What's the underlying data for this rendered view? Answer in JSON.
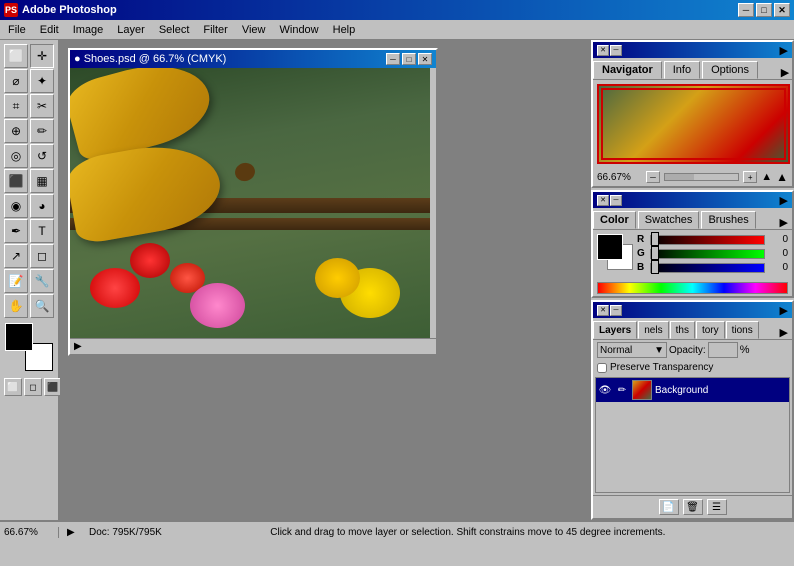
{
  "app": {
    "title": "Adobe Photoshop",
    "icon": "PS"
  },
  "titlebar": {
    "minimize": "─",
    "maximize": "□",
    "close": "✕"
  },
  "menubar": {
    "items": [
      "File",
      "Edit",
      "Image",
      "Layer",
      "Select",
      "Filter",
      "View",
      "Window",
      "Help"
    ]
  },
  "imagewindow": {
    "title": "● Shoes.psd @ 66.7% (CMYK)",
    "minimize": "─",
    "maximize": "□",
    "close": "✕"
  },
  "navigator": {
    "title": "",
    "tabs": [
      "Navigator",
      "Info",
      "Options"
    ],
    "active_tab": "Navigator",
    "zoom": "66.67%",
    "arrow_expand": "▶"
  },
  "colorpanel": {
    "title": "",
    "tabs": [
      "Color",
      "Swatches",
      "Brushes"
    ],
    "active_tab": "Color",
    "r_label": "R",
    "g_label": "G",
    "b_label": "B",
    "r_value": "0",
    "g_value": "0",
    "b_value": "0",
    "arrow_expand": "▶"
  },
  "layerspanel": {
    "title": "",
    "tabs": [
      "Layers",
      "Channels",
      "Paths",
      "History",
      "Actions"
    ],
    "tabs_short": [
      "Layers",
      "nels",
      "ths",
      "tory",
      "tions"
    ],
    "active_tab": "Layers",
    "blend_mode": "Normal",
    "opacity_label": "Opacity:",
    "opacity_value": "",
    "preserve_label": "Preserve Transparency",
    "layer_name": "Background",
    "arrow_expand": "▶",
    "footer_btns": [
      "📄",
      "🗑",
      "📁"
    ]
  },
  "statusbar": {
    "zoom": "66.67%",
    "doc_info": "Doc: 795K/795K",
    "hint": "Click and drag to move layer or selection. Shift constrains move to 45 degree increments.",
    "arrow": "▶"
  },
  "tools": {
    "items": [
      {
        "name": "marquee",
        "icon": "⬜"
      },
      {
        "name": "move",
        "icon": "✛"
      },
      {
        "name": "lasso",
        "icon": "⌀"
      },
      {
        "name": "magic-wand",
        "icon": "✦"
      },
      {
        "name": "crop",
        "icon": "⌗"
      },
      {
        "name": "slice",
        "icon": "⚡"
      },
      {
        "name": "healing",
        "icon": "⊕"
      },
      {
        "name": "brush",
        "icon": "✏"
      },
      {
        "name": "clone",
        "icon": "◎"
      },
      {
        "name": "history",
        "icon": "↺"
      },
      {
        "name": "eraser",
        "icon": "⬛"
      },
      {
        "name": "gradient",
        "icon": "▦"
      },
      {
        "name": "blur",
        "icon": "◉"
      },
      {
        "name": "dodge",
        "icon": "◕"
      },
      {
        "name": "pen",
        "icon": "✒"
      },
      {
        "name": "text",
        "icon": "T"
      },
      {
        "name": "path-select",
        "icon": "↗"
      },
      {
        "name": "shape",
        "icon": "◻"
      },
      {
        "name": "notes",
        "icon": "📝"
      },
      {
        "name": "eyedropper",
        "icon": "💉"
      },
      {
        "name": "hand",
        "icon": "✋"
      },
      {
        "name": "zoom",
        "icon": "🔍"
      }
    ]
  }
}
